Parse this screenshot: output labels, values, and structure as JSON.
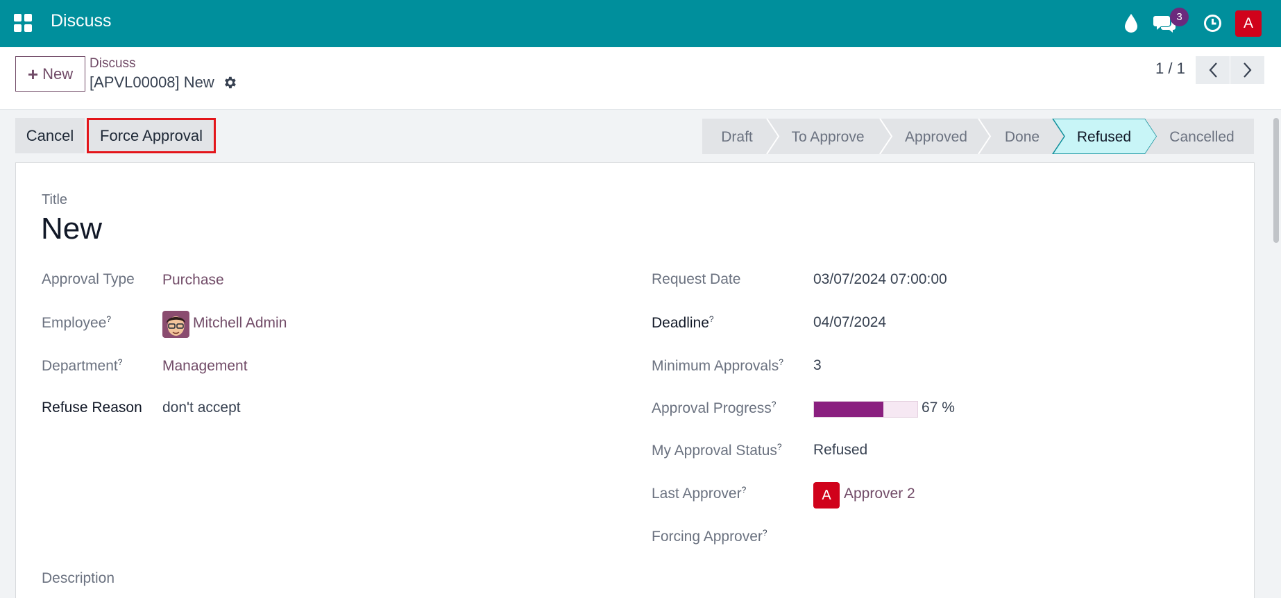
{
  "navbar": {
    "app_title": "Discuss",
    "message_count": "3",
    "user_initial": "A",
    "color": "#008f9c"
  },
  "control": {
    "new_label": "New",
    "breadcrumb_parent": "Discuss",
    "record_name": "[APVL00008] New",
    "pager": "1 / 1"
  },
  "actions": {
    "cancel_label": "Cancel",
    "force_label": "Force Approval"
  },
  "statusbar": {
    "stages": [
      "Draft",
      "To Approve",
      "Approved",
      "Done",
      "Refused",
      "Cancelled"
    ],
    "active": "Refused",
    "active_color": "#c8f5f7"
  },
  "form": {
    "title_label": "Title",
    "title_value": "New",
    "left": {
      "approval_type_label": "Approval Type",
      "approval_type_value": "Purchase",
      "employee_label": "Employee",
      "employee_value": "Mitchell Admin",
      "department_label": "Department",
      "department_value": "Management",
      "refuse_reason_label": "Refuse Reason",
      "refuse_reason_value": "don't accept"
    },
    "right": {
      "request_date_label": "Request Date",
      "request_date_value": "03/07/2024 07:00:00",
      "deadline_label": "Deadline",
      "deadline_value": "04/07/2024",
      "min_approvals_label": "Minimum Approvals",
      "min_approvals_value": "3",
      "progress_label": "Approval Progress",
      "progress_value": 67,
      "progress_text": "67 %",
      "my_status_label": "My Approval Status",
      "my_status_value": "Refused",
      "last_approver_label": "Last Approver",
      "last_approver_initial": "A",
      "last_approver_value": "Approver 2",
      "forcing_approver_label": "Forcing Approver"
    },
    "description_label": "Description",
    "help_mark": "?"
  },
  "colors": {
    "primary": "#714b67",
    "progress": "#8a1f7f",
    "avatar": "#d0021b"
  }
}
